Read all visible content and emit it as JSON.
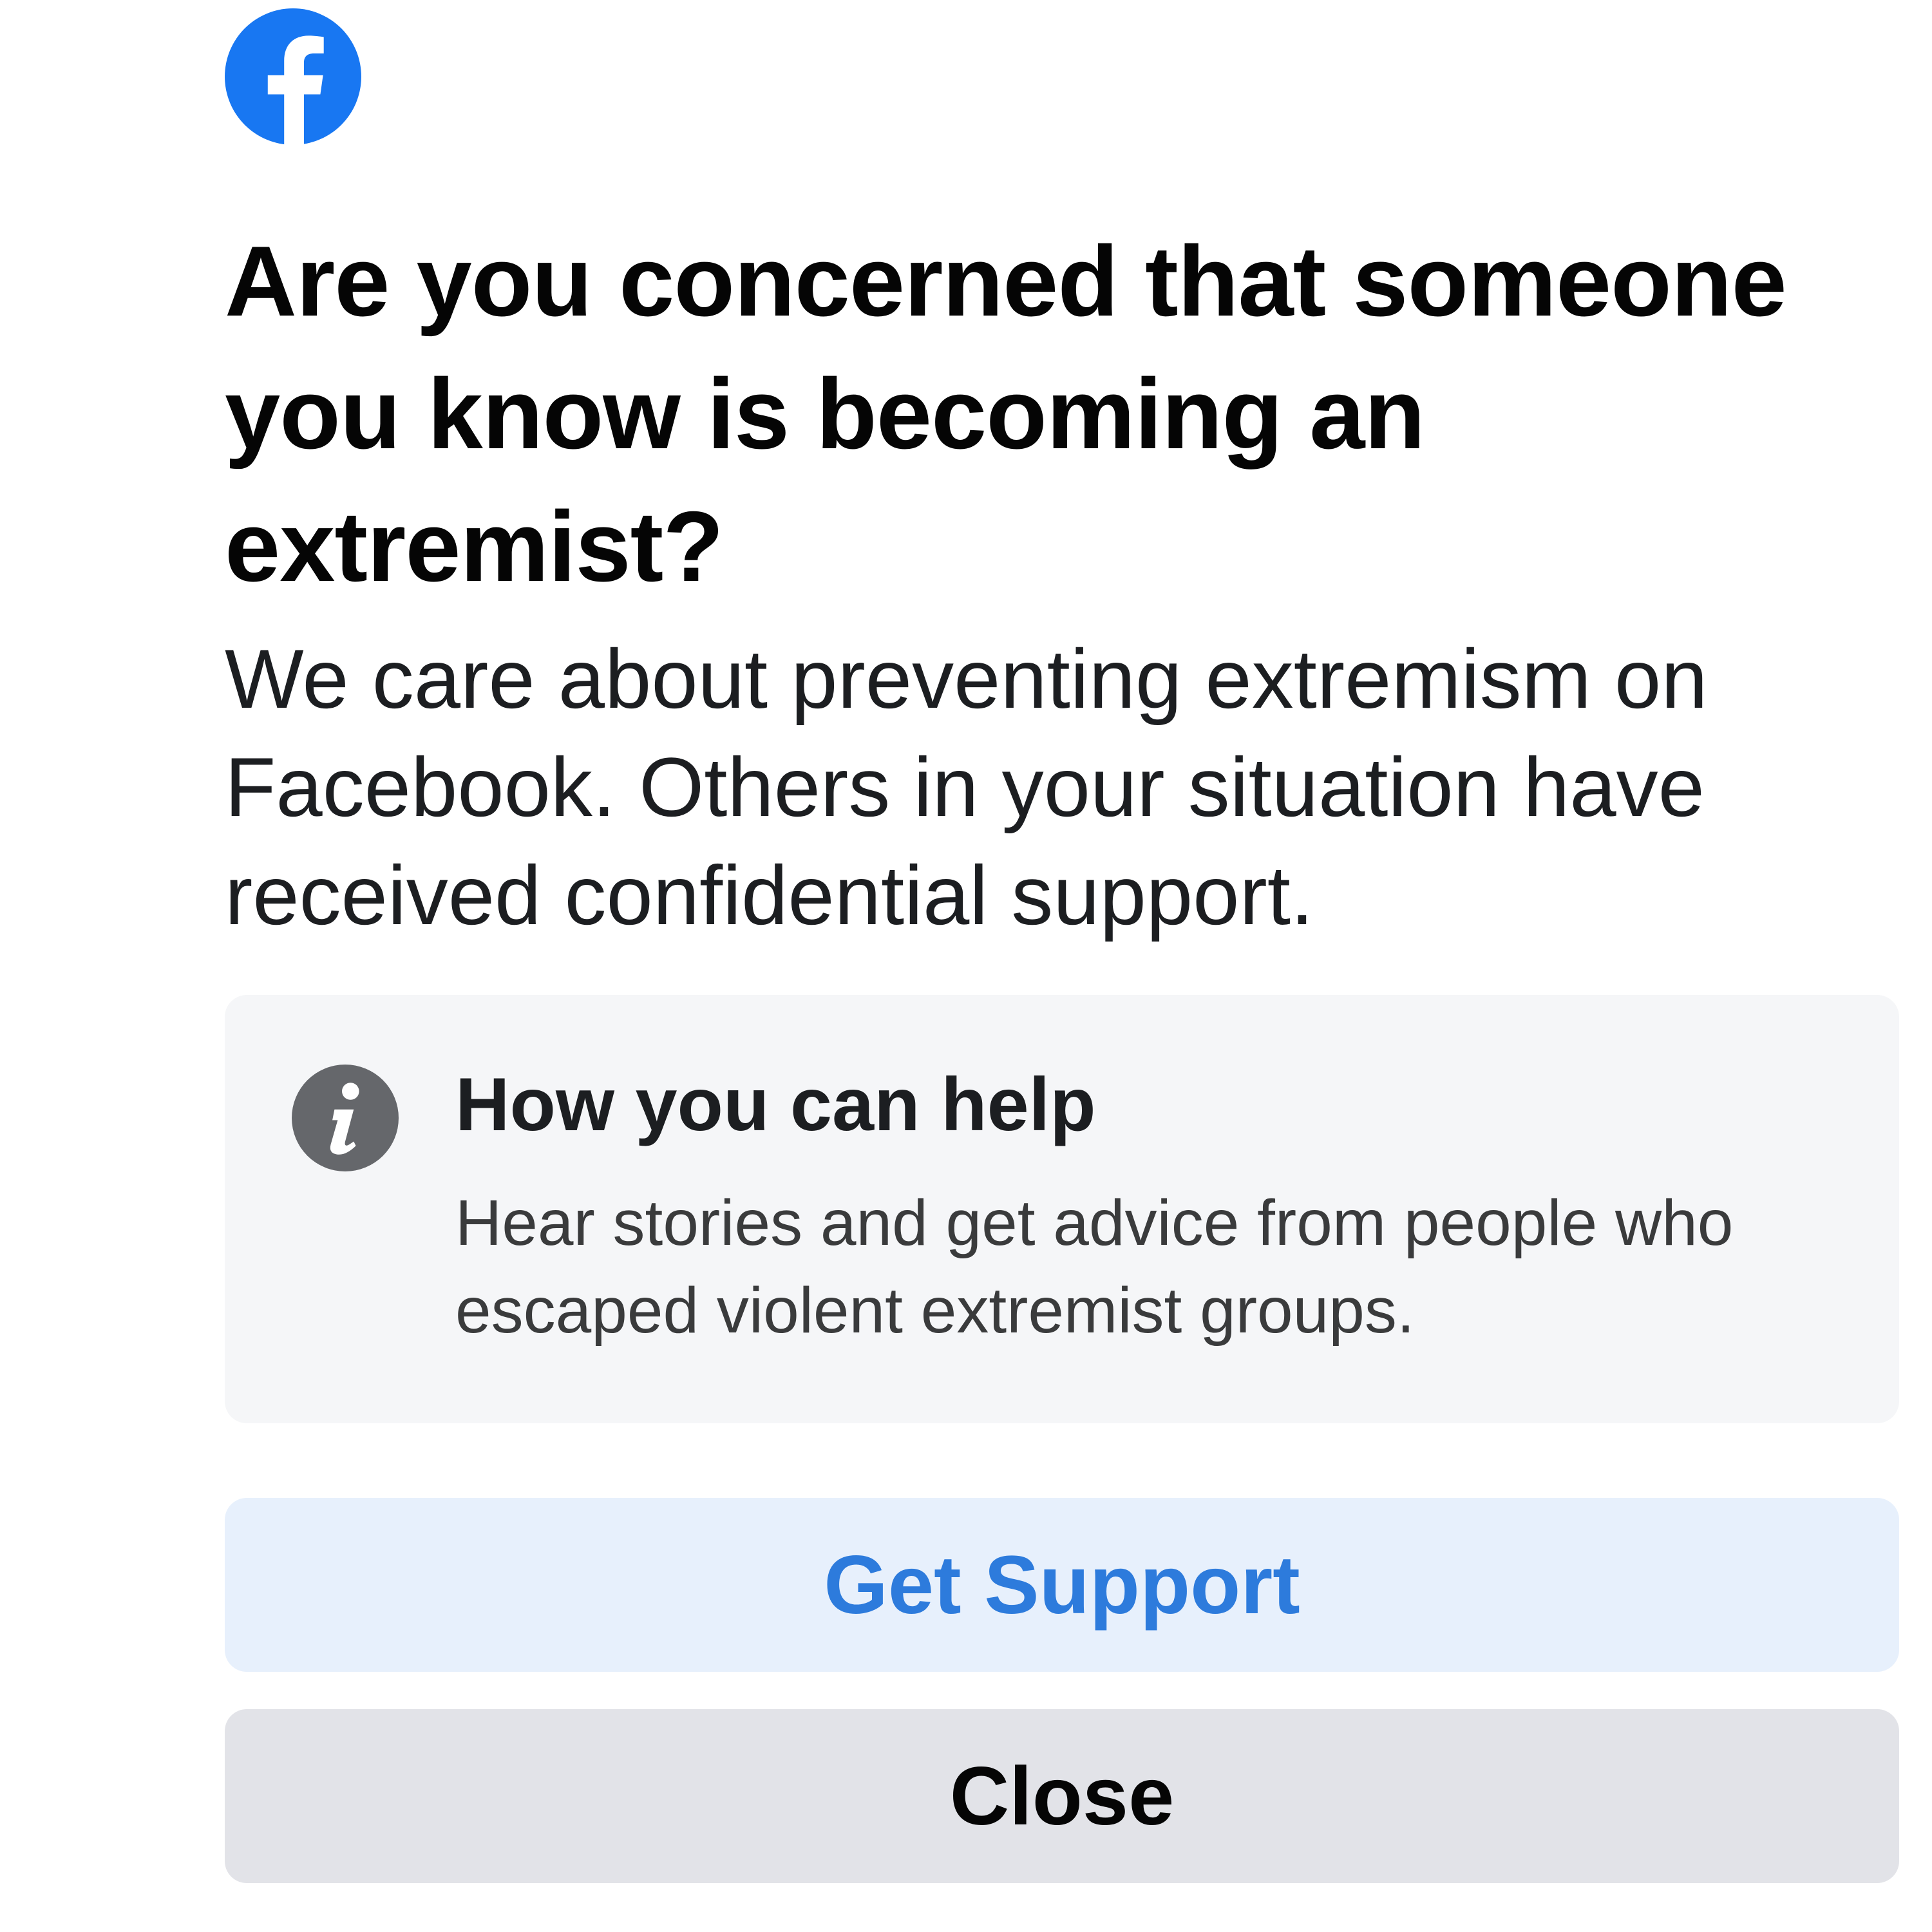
{
  "brand": {
    "logo_icon": "facebook-logo-icon",
    "color": "#1877f2"
  },
  "dialog": {
    "title": "Are you concerned that someone you know is becoming an extremist?",
    "body": "We care about preventing extremism on Facebook. Others in your situation have received confidential support."
  },
  "info_card": {
    "icon": "info-icon",
    "heading": "How you can help",
    "description": "Hear stories and get advice from people who escaped violent extremist groups."
  },
  "actions": {
    "primary_label": "Get Support",
    "secondary_label": "Close",
    "primary_color": "#2d7bdc"
  }
}
